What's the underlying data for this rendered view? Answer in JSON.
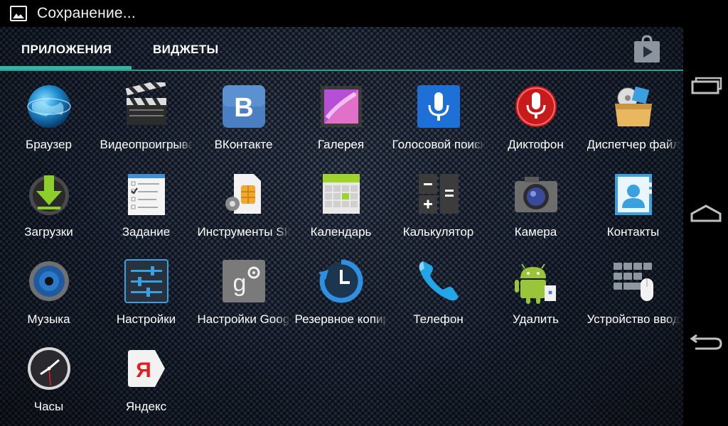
{
  "status_bar": {
    "text": "Сохранение...",
    "icon": "image-icon"
  },
  "tabs": {
    "apps": "ПРИЛОЖЕНИЯ",
    "widgets": "ВИДЖЕТЫ",
    "store_icon": "play-store-icon"
  },
  "colors": {
    "accent": "#33b5a5",
    "nav_bg": "#000000",
    "drawer_bg": "#1d2634"
  },
  "apps": [
    {
      "label": "Браузер",
      "icon": "browser-globe-icon"
    },
    {
      "label": "Видеопроигрыватель",
      "icon": "clapperboard-icon"
    },
    {
      "label": "ВКонтакте",
      "icon": "vk-icon"
    },
    {
      "label": "Галерея",
      "icon": "gallery-icon"
    },
    {
      "label": "Голосовой поиск",
      "icon": "microphone-icon"
    },
    {
      "label": "Диктофон",
      "icon": "recorder-icon"
    },
    {
      "label": "Диспетчер файлов",
      "icon": "file-manager-icon"
    },
    {
      "label": "Загрузки",
      "icon": "download-icon"
    },
    {
      "label": "Задание",
      "icon": "tasks-icon"
    },
    {
      "label": "Инструменты SIM",
      "icon": "sim-tools-icon"
    },
    {
      "label": "Календарь",
      "icon": "calendar-icon"
    },
    {
      "label": "Калькулятор",
      "icon": "calculator-icon"
    },
    {
      "label": "Камера",
      "icon": "camera-icon"
    },
    {
      "label": "Контакты",
      "icon": "contacts-icon"
    },
    {
      "label": "Музыка",
      "icon": "music-speaker-icon"
    },
    {
      "label": "Настройки",
      "icon": "settings-sliders-icon"
    },
    {
      "label": "Настройки Google",
      "icon": "google-settings-icon"
    },
    {
      "label": "Резервное копирование",
      "icon": "backup-clock-icon"
    },
    {
      "label": "Телефон",
      "icon": "phone-icon"
    },
    {
      "label": "Удалить",
      "icon": "android-uninstall-icon"
    },
    {
      "label": "Устройство ввода",
      "icon": "keyboard-mouse-icon"
    },
    {
      "label": "Часы",
      "icon": "clock-icon"
    },
    {
      "label": "Яндекс",
      "icon": "yandex-icon"
    }
  ],
  "nav": {
    "recents": "recents-icon",
    "home": "home-icon",
    "back": "back-icon"
  }
}
